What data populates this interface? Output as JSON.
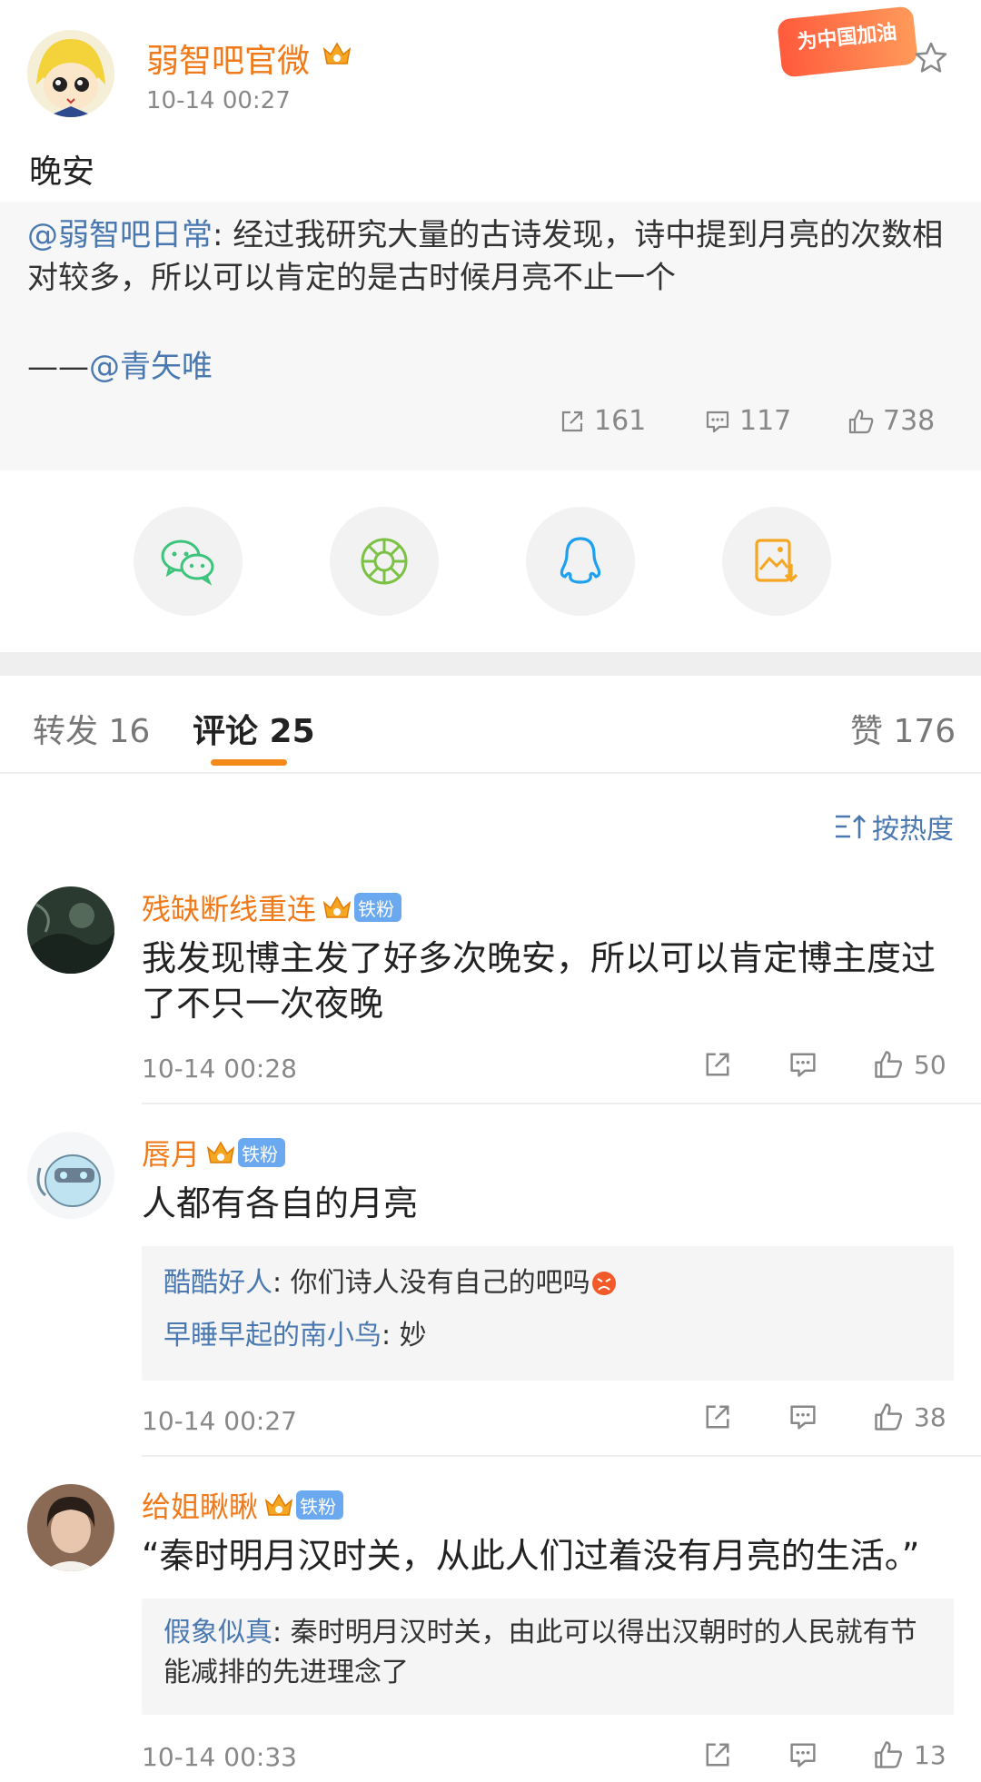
{
  "post": {
    "author": "弱智吧官微",
    "time": "10-14 00:27",
    "badge": "为中国加油",
    "text": "晚安",
    "quote_mention": "@弱智吧日常",
    "quote_body": ": 经过我研究大量的古诗发现，诗中提到月亮的次数相对较多，所以可以肯定的是古时候月亮不止一个",
    "quote_sig_dash": "——",
    "quote_sig_mention": "@青矢唯",
    "reposts": "161",
    "comments": "117",
    "likes": "738"
  },
  "share": {
    "items": [
      "wechat-icon",
      "moments-icon",
      "qq-icon",
      "save-image-icon"
    ]
  },
  "tabs": {
    "repost": "转发 16",
    "comment": "评论 25",
    "like": "赞 176"
  },
  "sort_label": "按热度",
  "comments": [
    {
      "name": "残缺断线重连",
      "fan_badge": "铁粉",
      "text": "我发现博主发了好多次晚安，所以可以肯定博主度过了不只一次夜晚",
      "time": "10-14 00:28",
      "likes": "50"
    },
    {
      "name": "唇月",
      "fan_badge": "铁粉",
      "text": "人都有各自的月亮",
      "time": "10-14 00:27",
      "likes": "38",
      "replies": [
        {
          "name": "酷酷好人",
          "text": ": 你们诗人没有自己的吧吗"
        },
        {
          "name": "早睡早起的南小鸟",
          "text": ": 妙"
        }
      ]
    },
    {
      "name": "给姐瞅瞅",
      "fan_badge": "铁粉",
      "text": "“秦时明月汉时关，从此人们过着没有月亮的生活。”",
      "time": "10-14 00:33",
      "likes": "13",
      "replies": [
        {
          "name": "假象似真",
          "text": ": 秦时明月汉时关，由此可以得出汉朝时的人民就有节能减排的先进理念了"
        }
      ]
    }
  ],
  "colors": {
    "accent": "#f07a1a",
    "link": "#4a78b0",
    "tab_indicator": "#f38a1a"
  }
}
